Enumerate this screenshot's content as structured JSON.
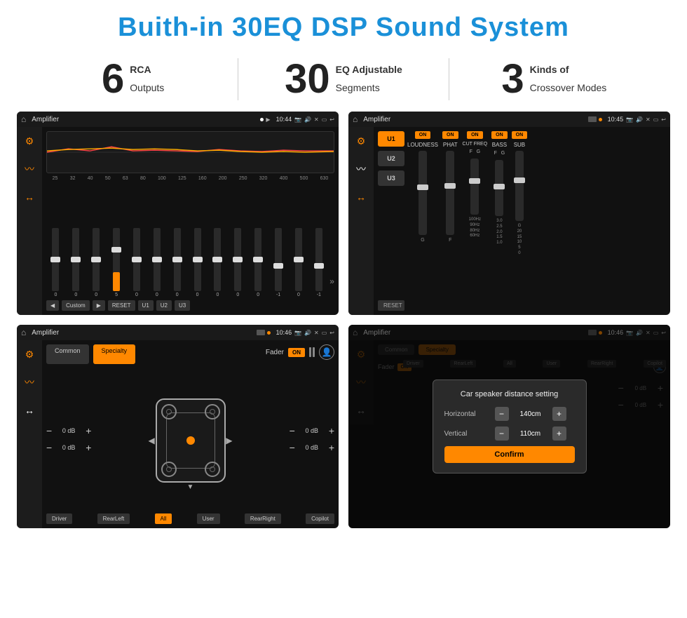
{
  "page": {
    "title": "Buith-in 30EQ DSP Sound System",
    "stats": [
      {
        "number": "6",
        "desc_line1": "RCA",
        "desc_line2": "Outputs"
      },
      {
        "number": "30",
        "desc_line1": "EQ Adjustable",
        "desc_line2": "Segments"
      },
      {
        "number": "3",
        "desc_line1": "Kinds of",
        "desc_line2": "Crossover Modes"
      }
    ]
  },
  "screens": {
    "eq": {
      "title": "Amplifier",
      "time": "10:44",
      "graph_label": "EQ Graph",
      "freq_labels": [
        "25",
        "32",
        "40",
        "50",
        "63",
        "80",
        "100",
        "125",
        "160",
        "200",
        "250",
        "320",
        "400",
        "500",
        "630"
      ],
      "sliders": [
        0,
        0,
        0,
        5,
        0,
        0,
        0,
        0,
        0,
        0,
        0,
        -1,
        0,
        -1
      ],
      "buttons": [
        "Custom",
        "RESET",
        "U1",
        "U2",
        "U3"
      ]
    },
    "crossover": {
      "title": "Amplifier",
      "time": "10:45",
      "presets": [
        "U1",
        "U2",
        "U3"
      ],
      "channels": [
        "LOUDNESS",
        "PHAT",
        "CUT FREQ",
        "BASS",
        "SUB"
      ],
      "reset_label": "RESET"
    },
    "fader": {
      "title": "Amplifier",
      "time": "10:46",
      "tabs": [
        "Common",
        "Specialty"
      ],
      "fader_label": "Fader",
      "on_label": "ON",
      "db_values": [
        "0 dB",
        "0 dB",
        "0 dB",
        "0 dB"
      ],
      "buttons": [
        "Driver",
        "RearLeft",
        "All",
        "User",
        "RearRight",
        "Copilot"
      ]
    },
    "distance": {
      "title": "Amplifier",
      "time": "10:46",
      "tabs": [
        "Common",
        "Specialty"
      ],
      "dialog_title": "Car speaker distance setting",
      "horizontal_label": "Horizontal",
      "horizontal_value": "140cm",
      "vertical_label": "Vertical",
      "vertical_value": "110cm",
      "confirm_label": "Confirm",
      "db_values": [
        "0 dB",
        "0 dB"
      ],
      "buttons": [
        "Driver",
        "RearLeft",
        "All",
        "User",
        "RearRight",
        "Copilot"
      ]
    }
  }
}
